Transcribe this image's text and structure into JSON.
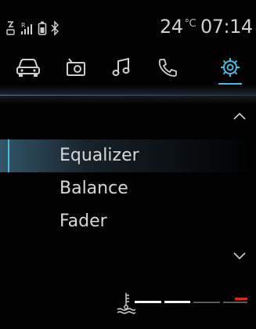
{
  "status": {
    "temperature": "24",
    "temperature_unit": "°C",
    "time": "07:14",
    "icons": [
      "signal-icon",
      "rssi-icon",
      "phone-battery-icon",
      "bluetooth-icon"
    ]
  },
  "tabs": [
    {
      "name": "car",
      "icon": "car-icon",
      "active": false
    },
    {
      "name": "media",
      "icon": "radio-icon",
      "active": false
    },
    {
      "name": "music",
      "icon": "music-note-icon",
      "active": false
    },
    {
      "name": "phone",
      "icon": "phone-icon",
      "active": false
    },
    {
      "name": "settings",
      "icon": "gear-icon",
      "active": true
    }
  ],
  "menu": {
    "items": [
      {
        "label": "Equalizer",
        "selected": true
      },
      {
        "label": "Balance",
        "selected": false
      },
      {
        "label": "Fader",
        "selected": false
      }
    ]
  },
  "coolant_gauge": {
    "icon": "coolant-temperature-icon",
    "segments_total": 4,
    "segments_lit": 2,
    "warning_color": "#e0241b"
  },
  "colors": {
    "accent": "#4fb8d8",
    "text": "#d8d8d8",
    "background": "#000000"
  }
}
